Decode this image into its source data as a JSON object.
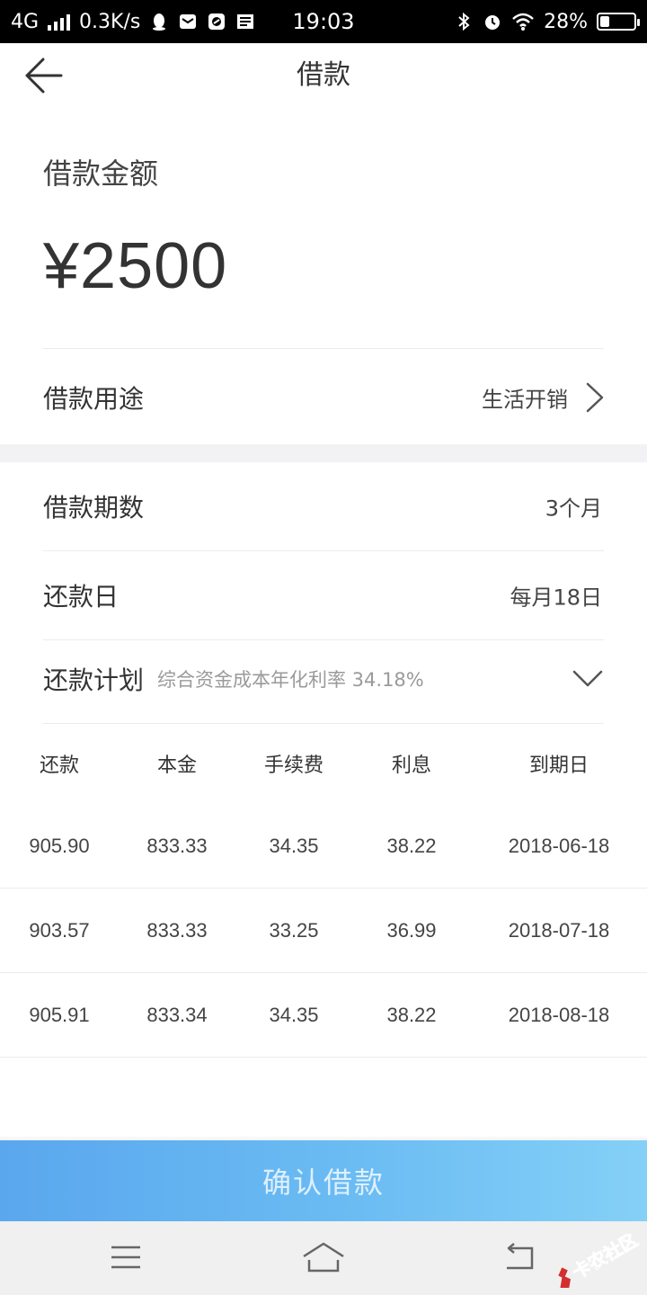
{
  "status_bar": {
    "network": "4G",
    "speed": "0.3K/s",
    "time": "19:03",
    "battery": "28%",
    "battery_level": 0.28
  },
  "header": {
    "title": "借款"
  },
  "loan": {
    "amount_label": "借款金额",
    "amount_value": "¥2500",
    "purpose_label": "借款用途",
    "purpose_value": "生活开销",
    "term_label": "借款期数",
    "term_value": "3个月",
    "repay_day_label": "还款日",
    "repay_day_value": "每月18日",
    "plan_label": "还款计划",
    "plan_rate_text": "综合资金成本年化利率  34.18%"
  },
  "table": {
    "headers": [
      "还款",
      "本金",
      "手续费",
      "利息",
      "到期日"
    ],
    "rows": [
      [
        "905.90",
        "833.33",
        "34.35",
        "38.22",
        "2018-06-18"
      ],
      [
        "903.57",
        "833.33",
        "33.25",
        "36.99",
        "2018-07-18"
      ],
      [
        "905.91",
        "833.34",
        "34.35",
        "38.22",
        "2018-08-18"
      ]
    ]
  },
  "actions": {
    "confirm_label": "确认借款"
  },
  "watermark": {
    "text": "卡农社区"
  },
  "colors": {
    "accent_start": "#5aa7ee",
    "accent_end": "#84d0f7",
    "watermark_red": "#d32f2f"
  },
  "icons": {
    "back": "arrow-left-icon",
    "chevron_right": "chevron-right-icon",
    "chevron_down": "chevron-down-icon",
    "menu": "menu-icon",
    "home": "home-icon",
    "return": "return-icon"
  }
}
